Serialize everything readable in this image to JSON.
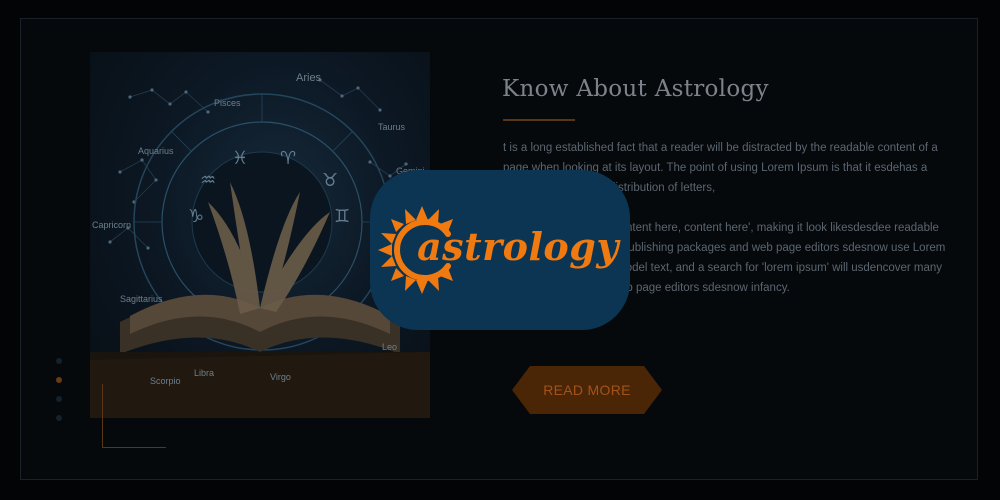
{
  "section": {
    "title": "Know About Astrology",
    "paragraph_1": "t is a long established fact that a reader will be distracted by the readable content of a page when looking at its layout. The point of using Lorem Ipsum is that it esdehas a more-or-less normal distribution of letters,",
    "paragraph_2": "as opposed to using 'Content here, content here', making it look likesdesdee readable English. Many desktop publishing packages and web page editors sdesnow use Lorem Ipsum as their default model text, and a search for 'lorem ipsum' will usdencover many web sites still in their web page editors sdesnow infancy.",
    "read_more_label": "READ MORE"
  },
  "hero_image": {
    "zodiac_labels": [
      "Aries",
      "Pisces",
      "Taurus",
      "Aquarius",
      "Gemini",
      "Capricorn",
      "Sagittarius",
      "Scorpio",
      "Libra",
      "Virgo",
      "Leo"
    ]
  },
  "slider": {
    "dot_count": 4,
    "active_index": 1
  },
  "logo": {
    "wordmark": "astrology"
  },
  "colors": {
    "accent": "#f07a10",
    "badge_background": "#0b3553",
    "page_background": "#020406",
    "button_background": "#4a2506"
  }
}
